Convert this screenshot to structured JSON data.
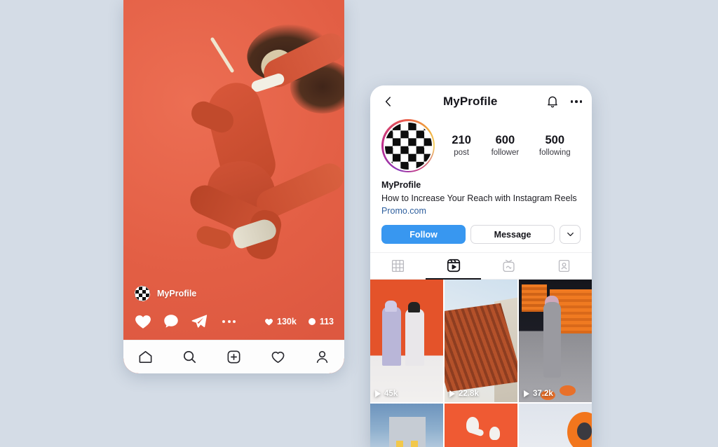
{
  "background_color": "#d4dce6",
  "feed_post": {
    "accent_color": "#e8654a",
    "username": "MyProfile",
    "avatar_icon": "checkerboard-avatar",
    "actions": [
      {
        "icon": "heart-icon",
        "name": "like-button"
      },
      {
        "icon": "comment-icon",
        "name": "comment-button"
      },
      {
        "icon": "share-icon",
        "name": "share-button"
      },
      {
        "icon": "more-dots-icon",
        "name": "more-options-button"
      }
    ],
    "likes": "130k",
    "comments": "113",
    "bottom_nav": [
      {
        "icon": "home-icon",
        "name": "nav-home"
      },
      {
        "icon": "search-icon",
        "name": "nav-search"
      },
      {
        "icon": "add-post-icon",
        "name": "nav-add-post"
      },
      {
        "icon": "heart-icon",
        "name": "nav-activity"
      },
      {
        "icon": "person-icon",
        "name": "nav-profile"
      }
    ]
  },
  "profile": {
    "header": {
      "back_icon": "chevron-left-icon",
      "title": "MyProfile",
      "bell_icon": "bell-icon",
      "menu_icon": "more-dots-icon"
    },
    "avatar_icon": "checkerboard-avatar",
    "avatar_ring_colors": [
      "#8a3ab9",
      "#bc2a8d",
      "#e95950",
      "#f0a63a",
      "#f6d365"
    ],
    "stats": [
      {
        "value": "210",
        "label": "post"
      },
      {
        "value": "600",
        "label": "follower"
      },
      {
        "value": "500",
        "label": "following"
      }
    ],
    "bio": {
      "name": "MyProfile",
      "description": "How to Increase Your Reach with Instagram Reels",
      "link": "Promo.com",
      "link_color": "#2e5f9e"
    },
    "buttons": {
      "follow": "Follow",
      "follow_color": "#3897f0",
      "message": "Message",
      "more_icon": "chevron-down-icon"
    },
    "tabs": [
      {
        "icon": "grid-icon",
        "name": "tab-grid",
        "active": false
      },
      {
        "icon": "reels-icon",
        "name": "tab-reels",
        "active": true
      },
      {
        "icon": "igtv-icon",
        "name": "tab-igtv",
        "active": false
      },
      {
        "icon": "tagged-icon",
        "name": "tab-tagged",
        "active": false
      }
    ],
    "grid": [
      {
        "art": "a1",
        "views": "45k",
        "alt": "two people in front of orange wall"
      },
      {
        "art": "a2",
        "views": "22.8k",
        "alt": "angled building roof against sky"
      },
      {
        "art": "a3",
        "views": "37.2k",
        "alt": "person standing on orange stools"
      },
      {
        "art": "b1",
        "views": "",
        "alt": "house at dusk with lit windows"
      },
      {
        "art": "b2",
        "views": "",
        "alt": "wireless earbuds on orange background"
      },
      {
        "art": "b3",
        "views": "",
        "alt": "orange ring object on grey background"
      }
    ]
  }
}
